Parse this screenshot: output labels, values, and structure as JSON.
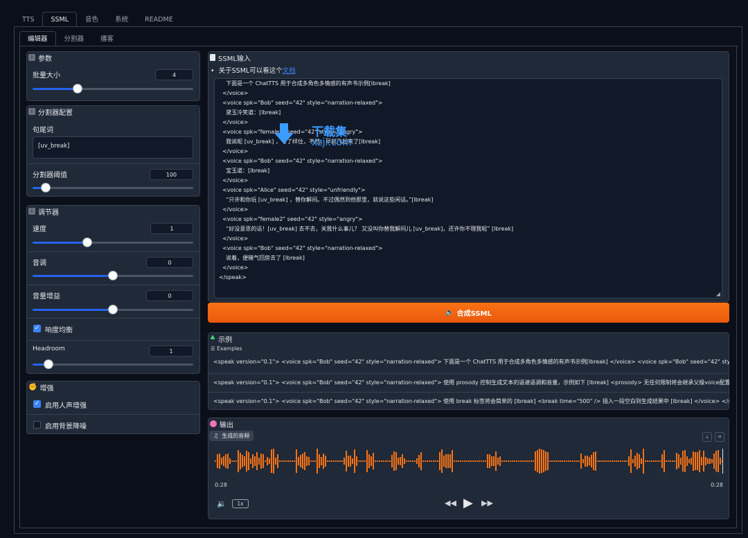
{
  "top_tabs": [
    "TTS",
    "SSML",
    "音色",
    "系统",
    "README"
  ],
  "sub_tabs": [
    "编辑器",
    "分割器",
    "播客"
  ],
  "params": {
    "title": "参数",
    "batch_label": "批量大小",
    "batch_value": "4",
    "batch_fraction": 0.28
  },
  "splitter": {
    "title": "分割器配置",
    "eos_label": "句尾词",
    "eos_value": "[uv_break]",
    "threshold_label": "分割器阈值",
    "threshold_value": "100",
    "threshold_fraction": 0.08
  },
  "tuner": {
    "title": "调节器",
    "speed_label": "速度",
    "speed_value": "1",
    "speed_fraction": 0.34,
    "pitch_label": "音调",
    "pitch_value": "0",
    "pitch_fraction": 0.5,
    "gain_label": "音量增益",
    "gain_value": "0",
    "gain_fraction": 0.5,
    "loudness_label": "响度均衡",
    "loudness_checked": true,
    "headroom_label": "Headroom",
    "headroom_value": "1",
    "headroom_fraction": 0.1
  },
  "enhance": {
    "title": "增强",
    "vocal_label": "启用人声增强",
    "vocal_checked": true,
    "denoise_label": "启用背景降噪",
    "denoise_checked": false
  },
  "ssml": {
    "title": "SSML输入",
    "info_prefix": "关于SSML可以看这个",
    "info_link": "文档",
    "lines": [
      "    下面是一个 ChatTTS 用于合成多角色多情感的有声书示例[lbreak]",
      "  </voice>",
      "  <voice spk=\"Bob\" seed=\"42\" style=\"narration-relaxed\">",
      "    黛玉冷笑道：[lbreak]",
      "  </voice>",
      "  <voice spk=\"female2\" seed=\"42\" style=\"angry\">",
      "    我说呢 [uv_break] ，亏了绊住，不然，早就飞起来了[lbreak]",
      "  </voice>",
      "  <voice spk=\"Bob\" seed=\"42\" style=\"narration-relaxed\">",
      "    宝玉道：[lbreak]",
      "  </voice>",
      "  <voice spk=\"Alice\" seed=\"42\" style=\"unfriendly\">",
      "    “只许和你玩 [uv_break] ，替你解闷。不过偶然到他那里，就说这些闲话。”[lbreak]",
      "  </voice>",
      "  <voice spk=\"female2\" seed=\"42\" style=\"angry\">",
      "    “好没意思的话！[uv_break] 去不去，关我什么事儿？ 又没叫你替我解闷儿 [uv_break]，还许你不理我呢” [lbreak]",
      "  </voice>",
      "  <voice spk=\"Bob\" seed=\"42\" style=\"narration-relaxed\">",
      "    说着，便赌气回房去了 [lbreak]",
      "  </voice>",
      "</speak>"
    ],
    "button": "合成SSML"
  },
  "examples": {
    "title": "示例",
    "sub": "Examples",
    "rows": [
      "<speak version=\"0.1\"> <voice spk=\"Bob\" seed=\"42\" style=\"narration-relaxed\"> 下面是一个 ChatTTS 用于合成多角色多情感的有声书示例[lbreak] </voice> <voice spk=\"Bob\" seed=\"42\" style=\"narration-relaxed\">",
      "<speak version=\"0.1\"> <voice spk=\"Bob\" seed=\"42\" style=\"narration-relaxed\"> 使用 prosody 控制生成文本的语速语调和音量，示例如下 [lbreak] <prosody> 无任何限制将会继承父级voice配置进行生成 [lbreak] </prosody>",
      "<speak version=\"0.1\"> <voice spk=\"Bob\" seed=\"42\" style=\"narration-relaxed\"> 使用 break 标签将会简单的 [lbreak] <break time=\"500\" /> 插入一段空白到生成结果中 [lbreak] </voice> </speak>"
    ]
  },
  "output": {
    "title": "输出",
    "audio_label": "生成的音频",
    "time_start": "0:28",
    "time_end": "0:28",
    "speed": "1x"
  },
  "watermark": {
    "line1": "下载集",
    "line2": "xzji.com"
  },
  "colors": {
    "accent": "#f97316",
    "slider": "#2563eb",
    "background": "#0b0f19",
    "panel": "#1f2937"
  }
}
